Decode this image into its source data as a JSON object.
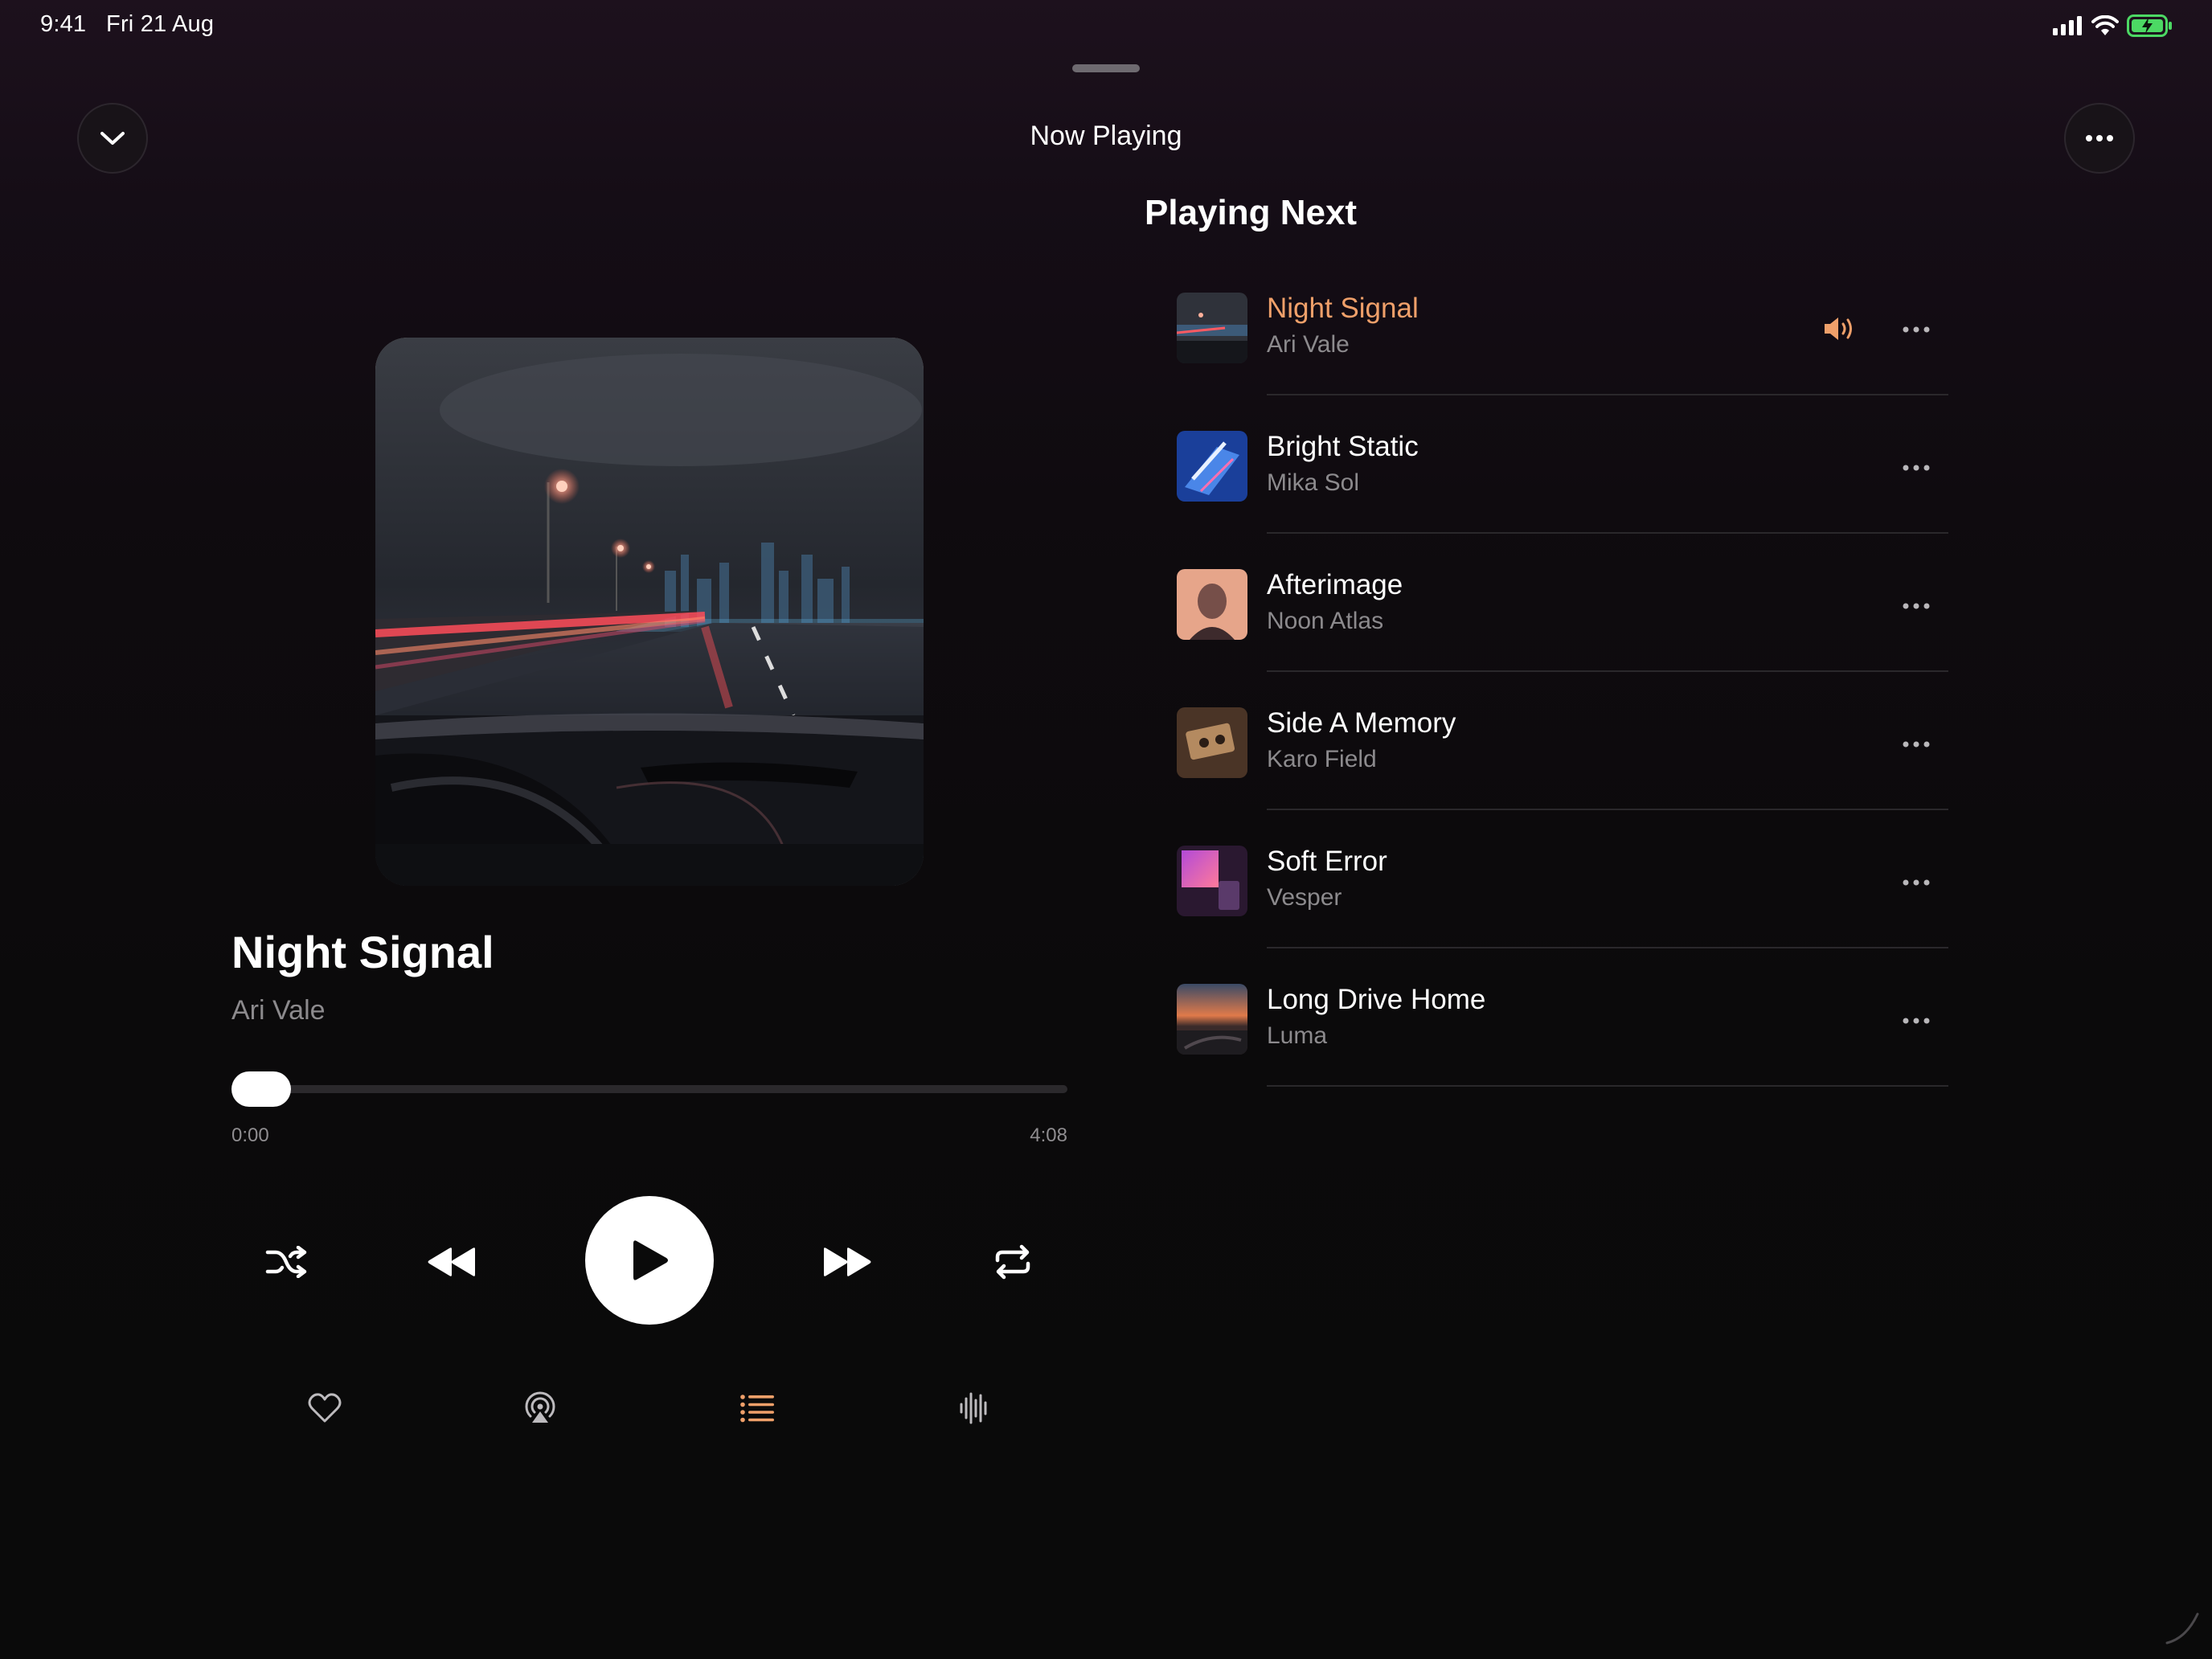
{
  "status_bar": {
    "time": "9:41",
    "date": "Fri 21 Aug"
  },
  "header": {
    "title": "Now Playing"
  },
  "now_playing": {
    "title": "Night Signal",
    "artist": "Ari Vale",
    "elapsed": "0:00",
    "duration": "4:08",
    "progress_fraction": 0.0
  },
  "queue": {
    "heading": "Playing Next",
    "items": [
      {
        "title": "Night Signal",
        "artist": "Ari Vale",
        "playing": true
      },
      {
        "title": "Bright Static",
        "artist": "Mika Sol",
        "playing": false
      },
      {
        "title": "Afterimage",
        "artist": "Noon Atlas",
        "playing": false
      },
      {
        "title": "Side A Memory",
        "artist": "Karo Field",
        "playing": false
      },
      {
        "title": "Soft Error",
        "artist": "Vesper",
        "playing": false
      },
      {
        "title": "Long Drive Home",
        "artist": "Luma",
        "playing": false
      }
    ]
  },
  "colors": {
    "accent": "#f0a06a",
    "battery": "#4cd964",
    "background": "#0b0a0b"
  },
  "icons": {
    "collapse": "chevron-down-icon",
    "more": "ellipsis-icon",
    "shuffle": "shuffle-icon",
    "previous": "backward-icon",
    "play": "play-icon",
    "next": "forward-icon",
    "repeat": "repeat-icon",
    "favorite": "heart-icon",
    "airplay": "airplay-icon",
    "queue": "list-icon",
    "waveform": "waveform-icon"
  }
}
